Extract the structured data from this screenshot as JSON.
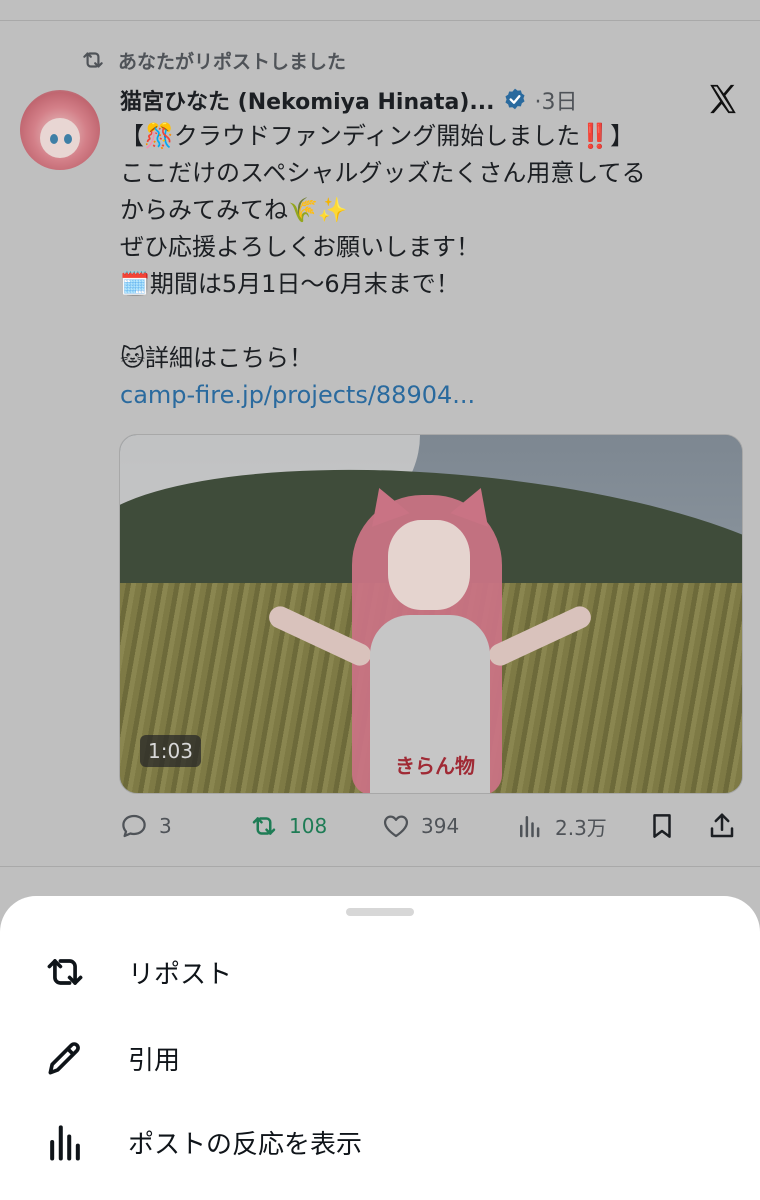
{
  "repost_notice": "あなたがリポストしました",
  "tweet": {
    "author": "猫宮ひなた (Nekomiya Hinata)...",
    "time": "·3日",
    "lines": [
      "【🎊クラウドファンディング開始しました‼️】",
      "ここだけのスペシャルグッズたくさん用意してる",
      "からみてみてね🌾✨",
      "ぜひ応援よろしくお願いします！",
      "🗓️期間は5月1日〜6月末まで！",
      "",
      "🐱詳細はこちら！"
    ],
    "link": "camp-fire.jp/projects/88904...",
    "media": {
      "shirt_text": "きらん物",
      "duration": "1:03"
    },
    "counts": {
      "replies": "3",
      "reposts": "108",
      "likes": "394",
      "views": "2.3万"
    }
  },
  "sheet": {
    "items": [
      {
        "label": "リポスト",
        "icon": "repost-icon"
      },
      {
        "label": "引用",
        "icon": "pencil-icon"
      },
      {
        "label": "ポストの反応を表示",
        "icon": "analytics-icon"
      }
    ]
  },
  "colors": {
    "overlay_bg": "#bfbfbf",
    "repost_green": "#1e7c55",
    "link_blue": "#2a6a9e",
    "verified_blue": "#1d9bf0"
  }
}
